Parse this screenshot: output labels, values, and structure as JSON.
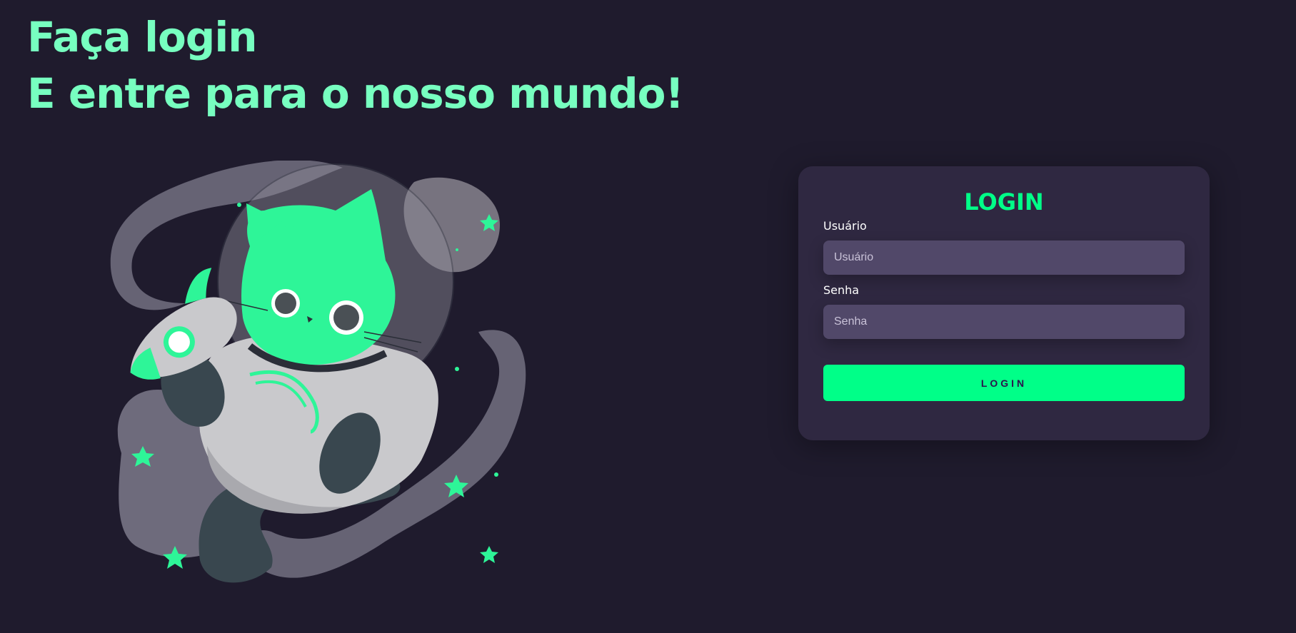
{
  "headline": {
    "line1": "Faça login",
    "line2": "E entre para o nosso mundo!"
  },
  "illustration": {
    "subject": "astronaut-cat-with-rocket",
    "accent_color": "#2ef598"
  },
  "login_card": {
    "title": "LOGIN",
    "username": {
      "label": "Usuário",
      "placeholder": "Usuário",
      "value": ""
    },
    "password": {
      "label": "Senha",
      "placeholder": "Senha",
      "value": ""
    },
    "submit_label": "LOGIN"
  },
  "colors": {
    "background": "#1f1b2d",
    "card": "#2f2841",
    "input": "#514869",
    "accent": "#00ff88",
    "headline": "#77ffc0"
  }
}
